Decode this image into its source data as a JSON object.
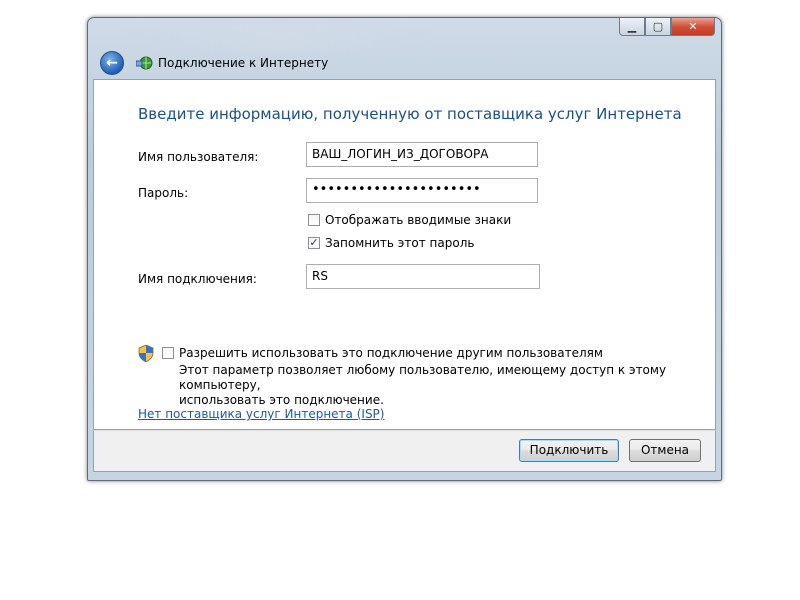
{
  "window": {
    "title": "Подключение к Интернету",
    "controls": [
      "minimize-icon",
      "maximize-icon",
      "close-icon"
    ]
  },
  "header": "Введите информацию, полученную от поставщика услуг Интернета",
  "form": {
    "username_label": "Имя пользователя:",
    "username_value": "ВАШ_ЛОГИН_ИЗ_ДОГОВОРА",
    "password_label": "Пароль:",
    "password_value": "••••••••••••••••••••••",
    "show_chars": {
      "label": "Отображать вводимые знаки",
      "checked": false
    },
    "remember_pw": {
      "label": "Запомнить этот пароль",
      "checked": true
    },
    "connection_name_label": "Имя подключения:",
    "connection_name_value": "RS"
  },
  "share": {
    "label": "Разрешить использовать это подключение другим пользователям",
    "checked": false,
    "description_line1": "Этот параметр позволяет любому пользователю, имеющему доступ к этому компьютеру,",
    "description_line2": "использовать это подключение."
  },
  "isp_link": "Нет поставщика услуг Интернета (ISP)",
  "buttons": {
    "connect": "Подключить",
    "cancel": "Отмена"
  }
}
